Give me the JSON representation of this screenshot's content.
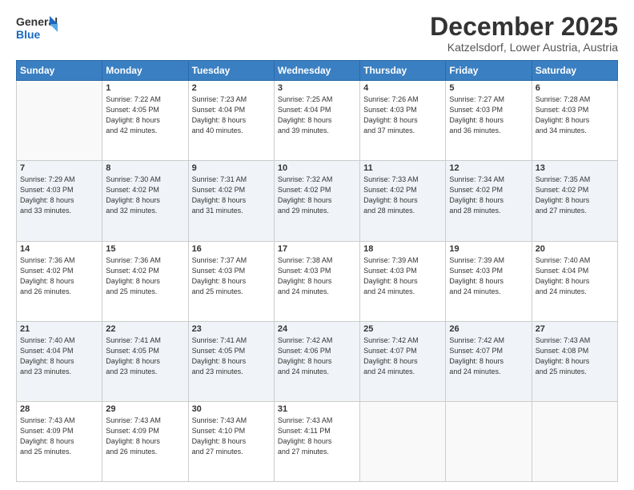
{
  "logo": {
    "line1": "General",
    "line2": "Blue"
  },
  "header": {
    "month": "December 2025",
    "location": "Katzelsdorf, Lower Austria, Austria"
  },
  "days_of_week": [
    "Sunday",
    "Monday",
    "Tuesday",
    "Wednesday",
    "Thursday",
    "Friday",
    "Saturday"
  ],
  "weeks": [
    [
      {
        "day": "",
        "info": ""
      },
      {
        "day": "1",
        "info": "Sunrise: 7:22 AM\nSunset: 4:05 PM\nDaylight: 8 hours\nand 42 minutes."
      },
      {
        "day": "2",
        "info": "Sunrise: 7:23 AM\nSunset: 4:04 PM\nDaylight: 8 hours\nand 40 minutes."
      },
      {
        "day": "3",
        "info": "Sunrise: 7:25 AM\nSunset: 4:04 PM\nDaylight: 8 hours\nand 39 minutes."
      },
      {
        "day": "4",
        "info": "Sunrise: 7:26 AM\nSunset: 4:03 PM\nDaylight: 8 hours\nand 37 minutes."
      },
      {
        "day": "5",
        "info": "Sunrise: 7:27 AM\nSunset: 4:03 PM\nDaylight: 8 hours\nand 36 minutes."
      },
      {
        "day": "6",
        "info": "Sunrise: 7:28 AM\nSunset: 4:03 PM\nDaylight: 8 hours\nand 34 minutes."
      }
    ],
    [
      {
        "day": "7",
        "info": "Sunrise: 7:29 AM\nSunset: 4:03 PM\nDaylight: 8 hours\nand 33 minutes."
      },
      {
        "day": "8",
        "info": "Sunrise: 7:30 AM\nSunset: 4:02 PM\nDaylight: 8 hours\nand 32 minutes."
      },
      {
        "day": "9",
        "info": "Sunrise: 7:31 AM\nSunset: 4:02 PM\nDaylight: 8 hours\nand 31 minutes."
      },
      {
        "day": "10",
        "info": "Sunrise: 7:32 AM\nSunset: 4:02 PM\nDaylight: 8 hours\nand 29 minutes."
      },
      {
        "day": "11",
        "info": "Sunrise: 7:33 AM\nSunset: 4:02 PM\nDaylight: 8 hours\nand 28 minutes."
      },
      {
        "day": "12",
        "info": "Sunrise: 7:34 AM\nSunset: 4:02 PM\nDaylight: 8 hours\nand 28 minutes."
      },
      {
        "day": "13",
        "info": "Sunrise: 7:35 AM\nSunset: 4:02 PM\nDaylight: 8 hours\nand 27 minutes."
      }
    ],
    [
      {
        "day": "14",
        "info": "Sunrise: 7:36 AM\nSunset: 4:02 PM\nDaylight: 8 hours\nand 26 minutes."
      },
      {
        "day": "15",
        "info": "Sunrise: 7:36 AM\nSunset: 4:02 PM\nDaylight: 8 hours\nand 25 minutes."
      },
      {
        "day": "16",
        "info": "Sunrise: 7:37 AM\nSunset: 4:03 PM\nDaylight: 8 hours\nand 25 minutes."
      },
      {
        "day": "17",
        "info": "Sunrise: 7:38 AM\nSunset: 4:03 PM\nDaylight: 8 hours\nand 24 minutes."
      },
      {
        "day": "18",
        "info": "Sunrise: 7:39 AM\nSunset: 4:03 PM\nDaylight: 8 hours\nand 24 minutes."
      },
      {
        "day": "19",
        "info": "Sunrise: 7:39 AM\nSunset: 4:03 PM\nDaylight: 8 hours\nand 24 minutes."
      },
      {
        "day": "20",
        "info": "Sunrise: 7:40 AM\nSunset: 4:04 PM\nDaylight: 8 hours\nand 24 minutes."
      }
    ],
    [
      {
        "day": "21",
        "info": "Sunrise: 7:40 AM\nSunset: 4:04 PM\nDaylight: 8 hours\nand 23 minutes."
      },
      {
        "day": "22",
        "info": "Sunrise: 7:41 AM\nSunset: 4:05 PM\nDaylight: 8 hours\nand 23 minutes."
      },
      {
        "day": "23",
        "info": "Sunrise: 7:41 AM\nSunset: 4:05 PM\nDaylight: 8 hours\nand 23 minutes."
      },
      {
        "day": "24",
        "info": "Sunrise: 7:42 AM\nSunset: 4:06 PM\nDaylight: 8 hours\nand 24 minutes."
      },
      {
        "day": "25",
        "info": "Sunrise: 7:42 AM\nSunset: 4:07 PM\nDaylight: 8 hours\nand 24 minutes."
      },
      {
        "day": "26",
        "info": "Sunrise: 7:42 AM\nSunset: 4:07 PM\nDaylight: 8 hours\nand 24 minutes."
      },
      {
        "day": "27",
        "info": "Sunrise: 7:43 AM\nSunset: 4:08 PM\nDaylight: 8 hours\nand 25 minutes."
      }
    ],
    [
      {
        "day": "28",
        "info": "Sunrise: 7:43 AM\nSunset: 4:09 PM\nDaylight: 8 hours\nand 25 minutes."
      },
      {
        "day": "29",
        "info": "Sunrise: 7:43 AM\nSunset: 4:09 PM\nDaylight: 8 hours\nand 26 minutes."
      },
      {
        "day": "30",
        "info": "Sunrise: 7:43 AM\nSunset: 4:10 PM\nDaylight: 8 hours\nand 27 minutes."
      },
      {
        "day": "31",
        "info": "Sunrise: 7:43 AM\nSunset: 4:11 PM\nDaylight: 8 hours\nand 27 minutes."
      },
      {
        "day": "",
        "info": ""
      },
      {
        "day": "",
        "info": ""
      },
      {
        "day": "",
        "info": ""
      }
    ]
  ]
}
